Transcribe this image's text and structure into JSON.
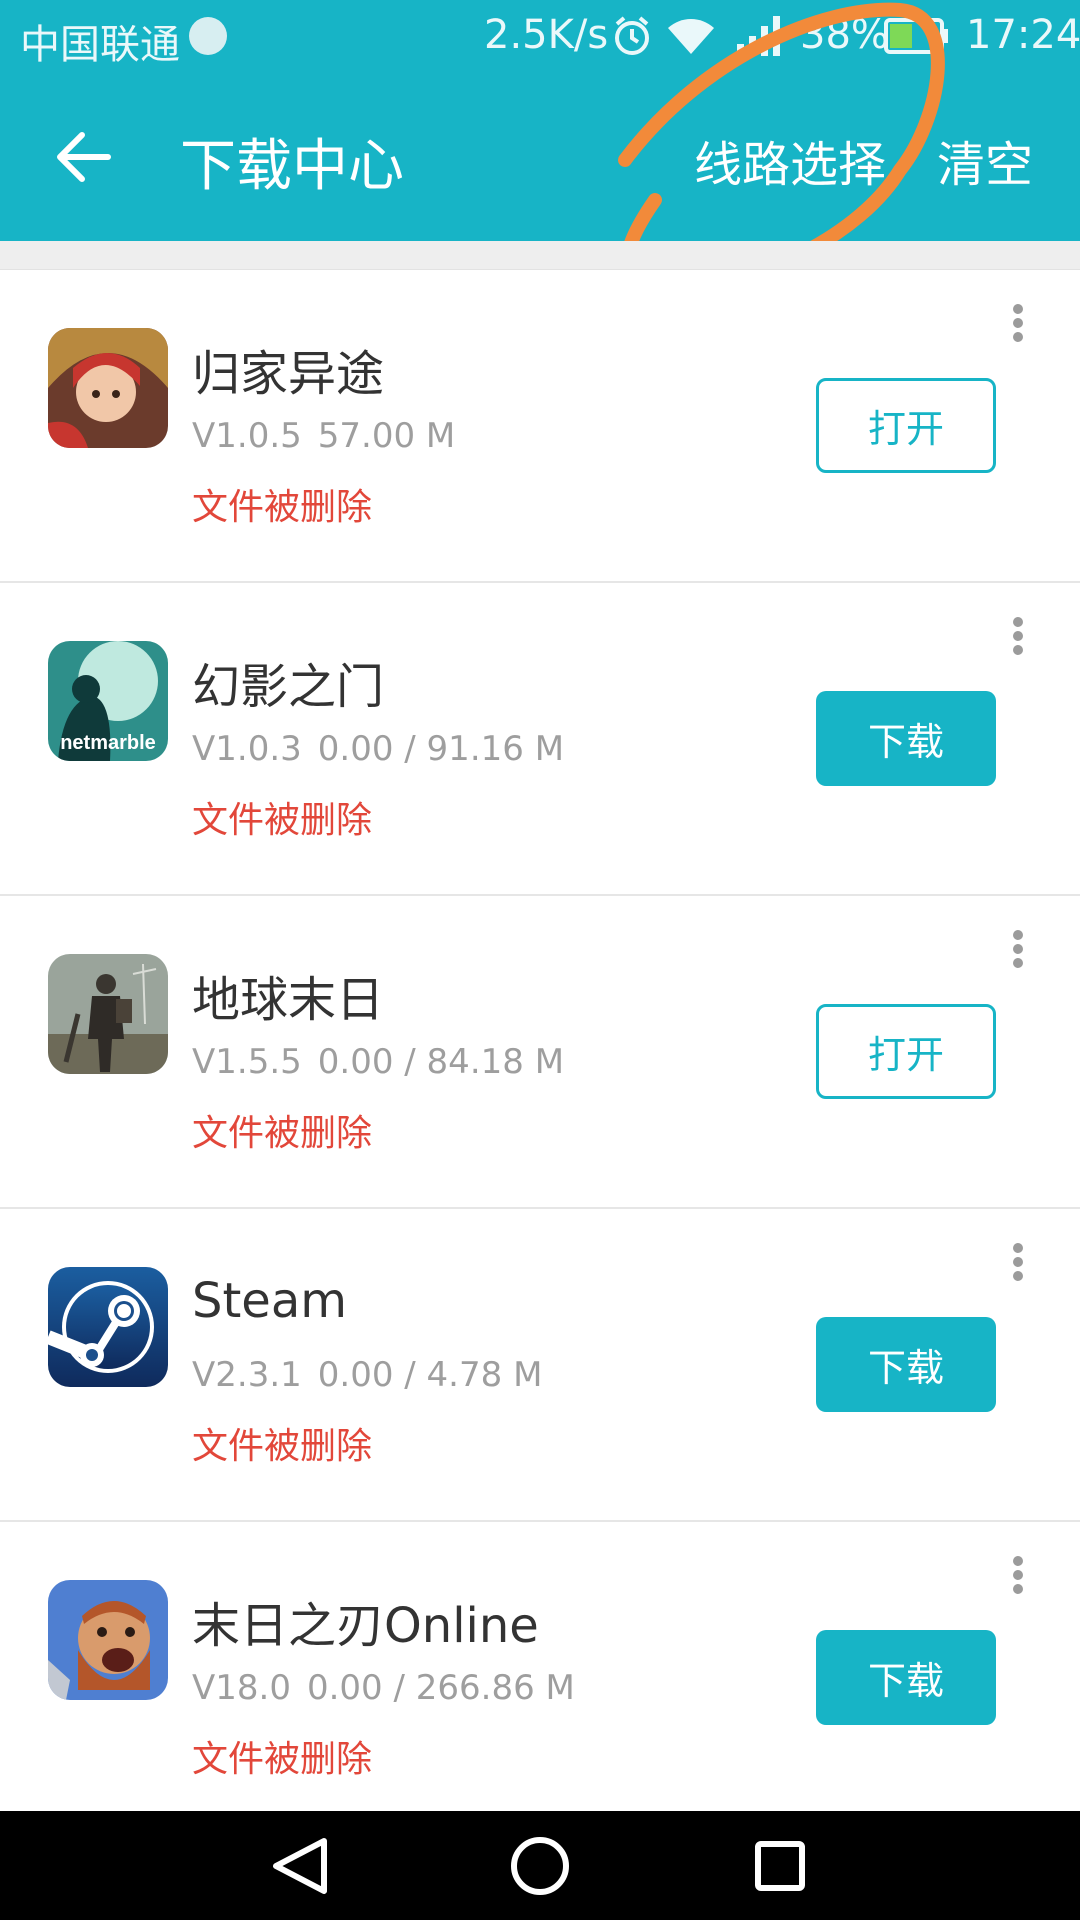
{
  "status_bar": {
    "carrier": "中国联通",
    "net_speed": "2.5K/s",
    "battery": "38%",
    "time": "17:24",
    "icons": [
      "carrier-badge-icon",
      "alarm-icon",
      "wifi-icon",
      "signal-icon",
      "battery-icon"
    ]
  },
  "app_bar": {
    "title": "下载中心",
    "route_select_label": "线路选择",
    "clear_label": "清空",
    "back_icon": "arrow-left-icon"
  },
  "annotation": {
    "description_color": "#f28a3a"
  },
  "apps": [
    {
      "name": "归家异途",
      "version": "V1.0.5",
      "size": "57.00 M",
      "status": "文件被删除",
      "action": "打开",
      "action_type": "open",
      "icon": "app-icon-guijia"
    },
    {
      "name": "幻影之门",
      "version": "V1.0.3",
      "size": "0.00 / 91.16 M",
      "status": "文件被删除",
      "action": "下载",
      "action_type": "download",
      "icon": "app-icon-huanying",
      "icon_text": "netmarble"
    },
    {
      "name": "地球末日",
      "version": "V1.5.5",
      "size": "0.00 / 84.18 M",
      "status": "文件被删除",
      "action": "打开",
      "action_type": "open",
      "icon": "app-icon-diqiu"
    },
    {
      "name": "Steam",
      "version": "V2.3.1",
      "size": "0.00 / 4.78 M",
      "status": "文件被删除",
      "action": "下载",
      "action_type": "download",
      "icon": "steam-icon"
    },
    {
      "name": "末日之刃Online",
      "version": "V18.0",
      "size": "0.00 / 266.86 M",
      "status": "文件被删除",
      "action": "下载",
      "action_type": "download",
      "icon": "app-icon-moriblade"
    }
  ],
  "colors": {
    "accent": "#17b4c6",
    "status_red": "#e2473a",
    "meta_gray": "#9e9e9e"
  },
  "nav": [
    "back-triangle-icon",
    "home-circle-icon",
    "recents-square-icon"
  ]
}
